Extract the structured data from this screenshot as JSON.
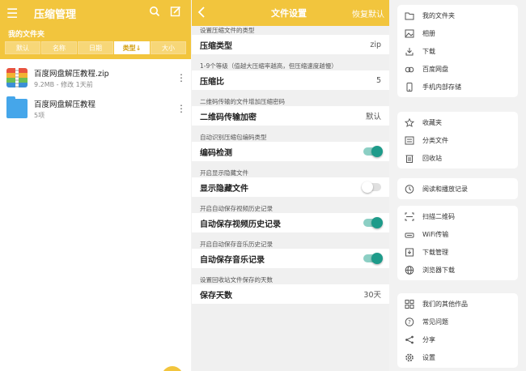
{
  "file_manager": {
    "title": "压缩管理",
    "section_title": "我的文件夹",
    "sort_options": [
      {
        "label": "默认",
        "active": false
      },
      {
        "label": "名称",
        "active": false
      },
      {
        "label": "日期",
        "active": false
      },
      {
        "label": "类型↓",
        "active": true
      },
      {
        "label": "大小",
        "active": false
      }
    ],
    "files": [
      {
        "name": "百度网盘解压教程.zip",
        "meta": "9.2MB - 修改 1天前",
        "type": "zip"
      },
      {
        "name": "百度网盘解压教程",
        "meta": "5项",
        "type": "folder"
      }
    ]
  },
  "settings": {
    "title": "文件设置",
    "reset_label": "恢复默认",
    "groups": [
      {
        "label": "设置压缩文件的类型",
        "name": "压缩类型",
        "value": "zip",
        "control": "value"
      },
      {
        "label": "1-9个等级（值越大压缩率越高，但压缩速度越慢）",
        "name": "压缩比",
        "value": "5",
        "control": "value"
      },
      {
        "label": "二维码传输的文件增加压缩密码",
        "name": "二维码传输加密",
        "value": "默认",
        "control": "value"
      },
      {
        "label": "自动识别压缩包编码类型",
        "name": "编码检测",
        "on": true,
        "control": "toggle"
      },
      {
        "label": "开启显示隐藏文件",
        "name": "显示隐藏文件",
        "on": false,
        "control": "toggle"
      },
      {
        "label": "开启自动保存视频历史记录",
        "name": "自动保存视频历史记录",
        "on": true,
        "control": "toggle"
      },
      {
        "label": "开启自动保存音乐历史记录",
        "name": "自动保存音乐记录",
        "on": true,
        "control": "toggle"
      },
      {
        "label": "设置回收站文件保存的天数",
        "name": "保存天数",
        "value": "30天",
        "control": "value"
      }
    ]
  },
  "menu": {
    "cards": [
      [
        {
          "label": "我的文件夹",
          "icon": "folder-icon"
        },
        {
          "label": "相册",
          "icon": "image-icon"
        },
        {
          "label": "下载",
          "icon": "download-icon"
        },
        {
          "label": "百度网盘",
          "icon": "baidu-netdisk-icon"
        },
        {
          "label": "手机内部存储",
          "icon": "phone-icon"
        }
      ],
      [
        {
          "label": "收藏夹",
          "icon": "star-icon"
        },
        {
          "label": "分类文件",
          "icon": "category-icon"
        },
        {
          "label": "回收站",
          "icon": "trash-icon"
        }
      ],
      [
        {
          "label": "阅读和播放记录",
          "icon": "clock-icon"
        }
      ],
      [
        {
          "label": "扫描二维码",
          "icon": "scan-icon"
        },
        {
          "label": "WiFi传输",
          "icon": "wifi-icon"
        },
        {
          "label": "下载管理",
          "icon": "download-manager-icon"
        },
        {
          "label": "浏览器下载",
          "icon": "browser-icon"
        }
      ],
      [
        {
          "label": "我们的其他作品",
          "icon": "apps-icon"
        },
        {
          "label": "常见问题",
          "icon": "help-icon"
        },
        {
          "label": "分享",
          "icon": "share-icon"
        },
        {
          "label": "设置",
          "icon": "settings-icon"
        }
      ]
    ]
  }
}
